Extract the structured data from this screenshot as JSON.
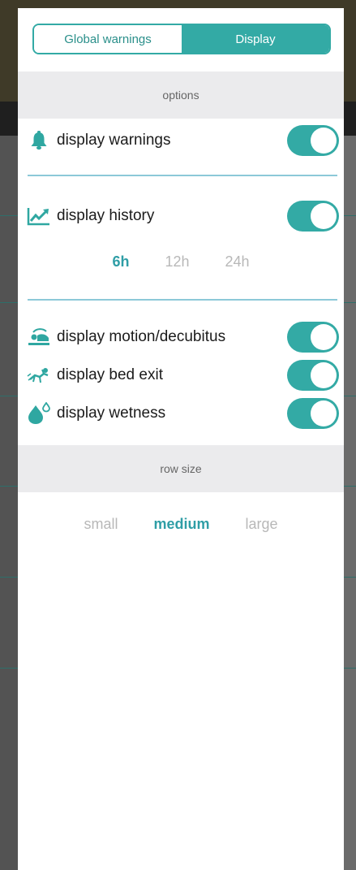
{
  "tabs": {
    "global_warnings": "Global warnings",
    "display": "Display",
    "active": "Display"
  },
  "options_header": "options",
  "toggles": [
    {
      "label": "display warnings",
      "icon": "bell-icon",
      "on": true
    },
    {
      "label": "display history",
      "icon": "chart-icon",
      "on": true
    },
    {
      "label": "display motion/decubitus",
      "icon": "motion-icon",
      "on": true
    },
    {
      "label": "display bed exit",
      "icon": "bed-exit-icon",
      "on": true
    },
    {
      "label": "display wetness",
      "icon": "wetness-icon",
      "on": true
    }
  ],
  "history_ranges": {
    "items": [
      "6h",
      "12h",
      "24h"
    ],
    "selected": "6h"
  },
  "row_size_header": "row size",
  "row_sizes": {
    "items": [
      "small",
      "medium",
      "large"
    ],
    "selected": "medium"
  },
  "colors": {
    "accent": "#33aaa5",
    "selected_text": "#2f9ea6",
    "divider": "#8cc9d8",
    "header_bg": "#ebebed"
  }
}
